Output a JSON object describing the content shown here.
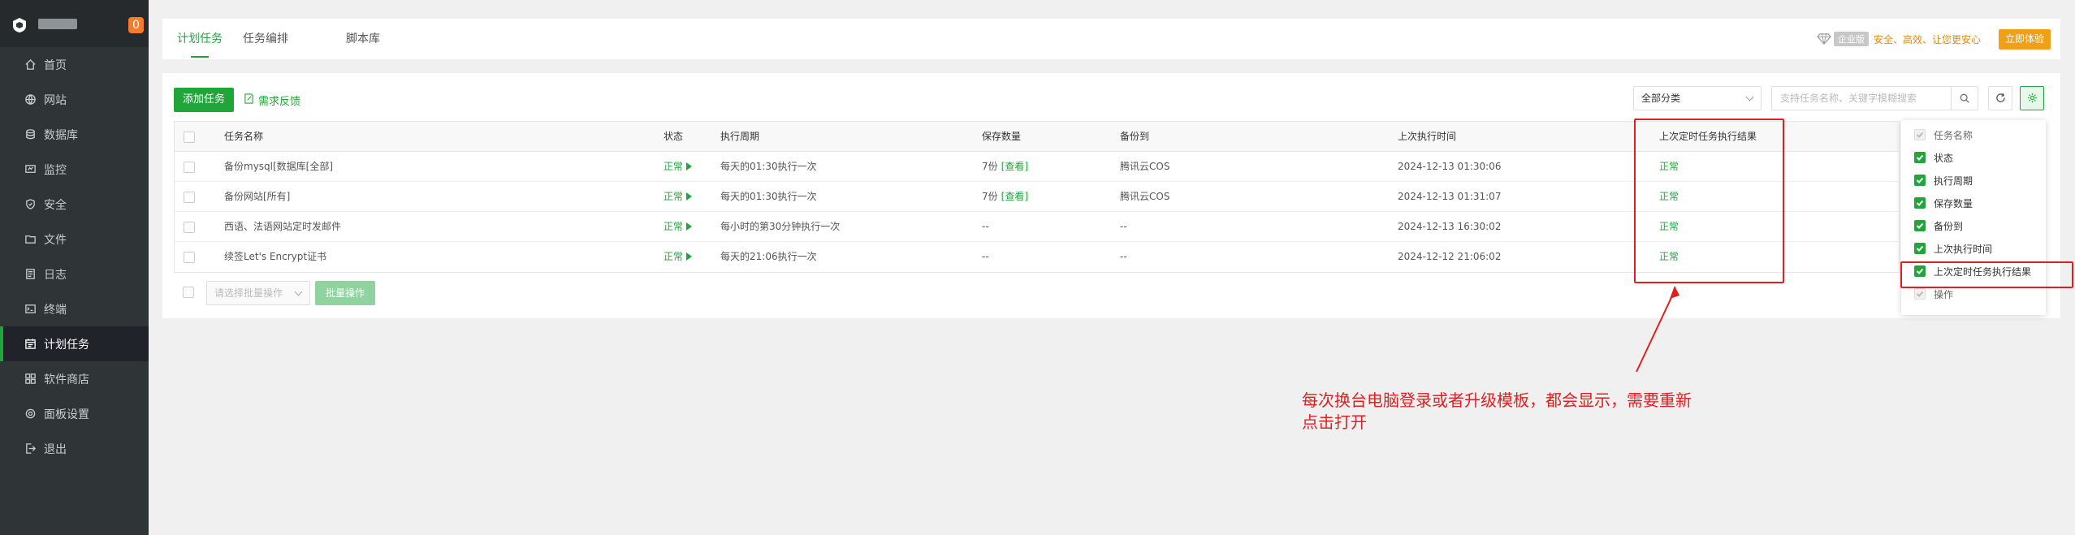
{
  "sidebar": {
    "badge": "0",
    "items": [
      {
        "label": "首页",
        "icon": "home-icon"
      },
      {
        "label": "网站",
        "icon": "globe-icon"
      },
      {
        "label": "数据库",
        "icon": "database-icon"
      },
      {
        "label": "监控",
        "icon": "monitor-icon"
      },
      {
        "label": "安全",
        "icon": "shield-icon"
      },
      {
        "label": "文件",
        "icon": "folder-icon"
      },
      {
        "label": "日志",
        "icon": "log-icon"
      },
      {
        "label": "终端",
        "icon": "terminal-icon"
      },
      {
        "label": "计划任务",
        "icon": "schedule-icon",
        "active": true
      },
      {
        "label": "软件商店",
        "icon": "store-icon"
      },
      {
        "label": "面板设置",
        "icon": "settings-icon"
      },
      {
        "label": "退出",
        "icon": "logout-icon"
      }
    ]
  },
  "tabs": [
    {
      "label": "计划任务",
      "active": true
    },
    {
      "label": "任务编排"
    },
    {
      "label": "脚本库"
    }
  ],
  "enterprise": {
    "tag": "企业版",
    "slogan": "安全、高效、让您更安心",
    "trial": "立即体验"
  },
  "toolbar": {
    "add_label": "添加任务",
    "feedback_label": "需求反馈",
    "category": "全部分类",
    "search_placeholder": "支持任务名称、关键字模糊搜索"
  },
  "table": {
    "headers": [
      "任务名称",
      "状态",
      "执行周期",
      "保存数量",
      "备份到",
      "上次执行时间",
      "上次定时任务执行结果"
    ],
    "rows": [
      {
        "name": "备份mysql[数据库[全部]",
        "status": "正常",
        "cycle": "每天的01:30执行一次",
        "keep": "7份",
        "view": "[查看]",
        "backup": "腾讯云COS",
        "last_time": "2024-12-13 01:30:06",
        "result": "正常"
      },
      {
        "name": "备份网站[所有]",
        "status": "正常",
        "cycle": "每天的01:30执行一次",
        "keep": "7份",
        "view": "[查看]",
        "backup": "腾讯云COS",
        "last_time": "2024-12-13 01:31:07",
        "result": "正常"
      },
      {
        "name": "西语、法语网站定时发邮件",
        "status": "正常",
        "cycle": "每小时的第30分钟执行一次",
        "keep": "--",
        "view": "",
        "backup": "--",
        "last_time": "2024-12-13 16:30:02",
        "result": "正常"
      },
      {
        "name": "续签Let's Encrypt证书",
        "status": "正常",
        "cycle": "每天的21:06执行一次",
        "keep": "--",
        "view": "",
        "backup": "--",
        "last_time": "2024-12-12 21:06:02",
        "result": "正常"
      }
    ]
  },
  "batch": {
    "select_placeholder": "请选择批量操作",
    "button_label": "批量操作"
  },
  "column_popup": {
    "items": [
      {
        "label": "任务名称",
        "state": "disabled"
      },
      {
        "label": "状态",
        "state": "checked"
      },
      {
        "label": "执行周期",
        "state": "checked"
      },
      {
        "label": "保存数量",
        "state": "checked"
      },
      {
        "label": "备份到",
        "state": "checked"
      },
      {
        "label": "上次执行时间",
        "state": "checked"
      },
      {
        "label": "上次定时任务执行结果",
        "state": "checked"
      },
      {
        "label": "操作",
        "state": "disabled"
      }
    ]
  },
  "annotation": {
    "line1": "每次换台电脑登录或者升级模板，都会显示，需要重新",
    "line2": "点击打开"
  },
  "colors": {
    "accent": "#20a53a",
    "annotation": "#e02020",
    "sidebar": "#2f3437"
  }
}
